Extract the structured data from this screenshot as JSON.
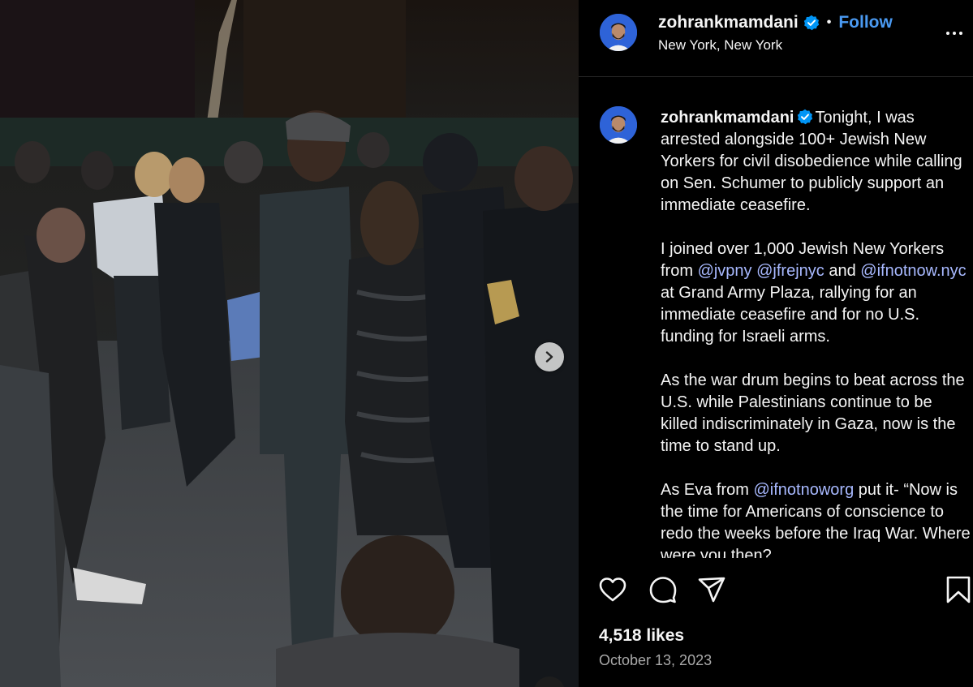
{
  "post": {
    "username": "zohrankmamdani",
    "follow_label": "Follow",
    "separator": "•",
    "location": "New York, New York",
    "caption": {
      "intro": "Tonight, I was arrested alongside 100+ Jewish New Yorkers for civil disobedience while calling on Sen. Schumer to publicly support an immediate ceasefire.",
      "p2_a": "I joined over 1,000 Jewish New Yorkers from ",
      "p2_m1": "@jvpny",
      "p2_space": " ",
      "p2_m2": "@jfrejnyc",
      "p2_b": " and ",
      "p2_m3": "@ifnotnow.nyc",
      "p2_c": " at Grand Army Plaza, rallying for an immediate ceasefire and for no U.S. funding for Israeli arms.",
      "p3": "As the war drum begins to beat across the U.S. while Palestinians continue to be killed indiscriminately in Gaza, now is the time to stand up.",
      "p4_a": "As Eva from ",
      "p4_m1": "@ifnotnoworg",
      "p4_b": " put it- “Now is the time for Americans of conscience to redo the weeks before the Iraq War. Where were you then?"
    },
    "likes": "4,518 likes",
    "date": "October 13, 2023"
  },
  "icons": {
    "verified": "verified-badge-icon",
    "like": "heart-icon",
    "comment": "comment-bubble-icon",
    "share": "paper-plane-icon",
    "save": "bookmark-icon",
    "more": "more-options-icon",
    "next": "chevron-right-icon"
  },
  "colors": {
    "accent": "#4a9af2",
    "mention": "#a8b9ff",
    "background": "#000000",
    "secondary_text": "#a8a8a8",
    "avatar_bg": "#2e63d8"
  }
}
